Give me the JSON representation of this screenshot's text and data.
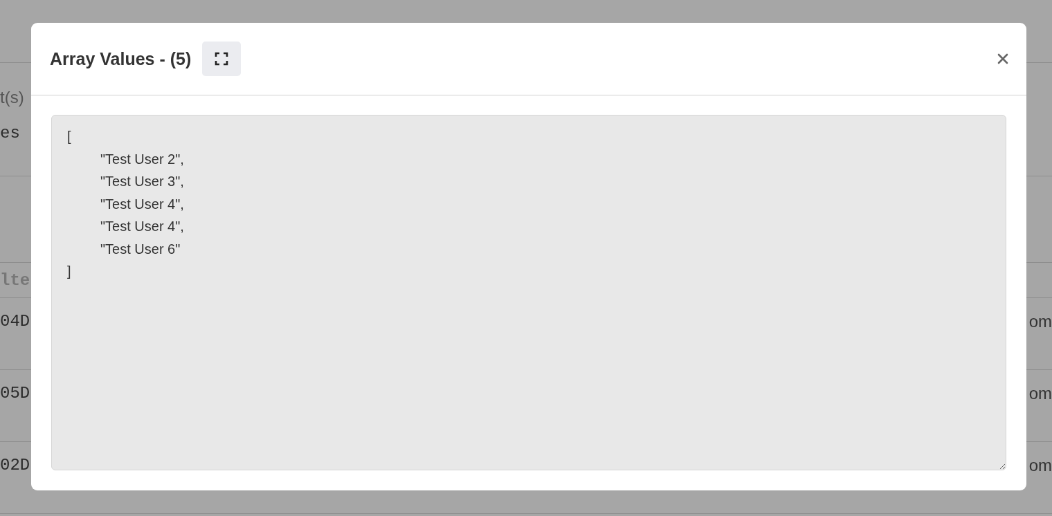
{
  "background": {
    "left_texts": [
      {
        "kind": "label",
        "text": "t(s)"
      },
      {
        "kind": "mono",
        "text": "es"
      }
    ],
    "table": {
      "header": "lte",
      "rows": [
        {
          "column_1": "04D",
          "column_2": "om"
        },
        {
          "column_1": "05D",
          "column_2": "om"
        },
        {
          "column_1": "02D",
          "column_2": "om"
        }
      ]
    }
  },
  "dialog": {
    "title": "Array Values - (5)",
    "value": "[\n\t\"Test User 2\",\n\t\"Test User 3\",\n\t\"Test User 4\",\n\t\"Test User 4\",\n\t\"Test User 6\"\n]"
  }
}
